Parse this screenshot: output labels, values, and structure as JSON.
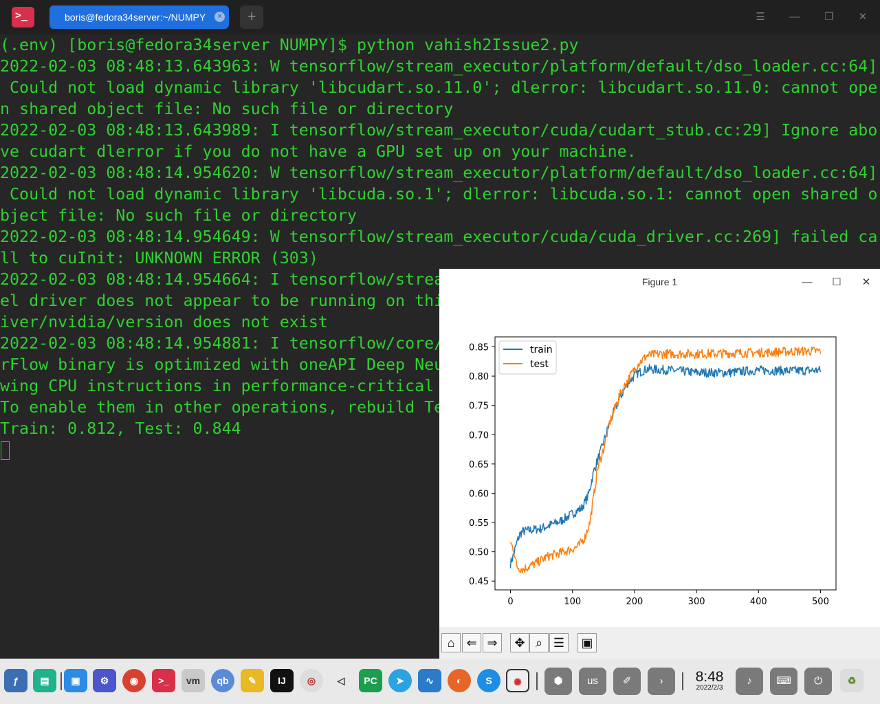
{
  "window": {
    "tab_title": "boris@fedora34server:~/NUMPY",
    "tab_close": "×",
    "new_tab": "+",
    "menu": "☰",
    "minimize": "—",
    "restore": "❐",
    "close": "✕"
  },
  "terminal": {
    "lines": [
      "(.env) [boris@fedora34server NUMPY]$ python vahish2Issue2.py",
      "2022-02-03 08:48:13.643963: W tensorflow/stream_executor/platform/default/dso_loader.cc:64]",
      " Could not load dynamic library 'libcudart.so.11.0'; dlerror: libcudart.so.11.0: cannot ope",
      "n shared object file: No such file or directory",
      "2022-02-03 08:48:13.643989: I tensorflow/stream_executor/cuda/cudart_stub.cc:29] Ignore abo",
      "ve cudart dlerror if you do not have a GPU set up on your machine.",
      "2022-02-03 08:48:14.954620: W tensorflow/stream_executor/platform/default/dso_loader.cc:64]",
      " Could not load dynamic library 'libcuda.so.1'; dlerror: libcuda.so.1: cannot open shared o",
      "bject file: No such file or directory",
      "2022-02-03 08:48:14.954649: W tensorflow/stream_executor/cuda/cuda_driver.cc:269] failed ca",
      "ll to cuInit: UNKNOWN ERROR (303)",
      "2022-02-03 08:48:14.954664: I tensorflow/strea",
      "el driver does not appear to be running on thi",
      "iver/nvidia/version does not exist",
      "2022-02-03 08:48:14.954881: I tensorflow/core/",
      "rFlow binary is optimized with oneAPI Deep Neu",
      "wing CPU instructions in performance-critical ",
      "To enable them in other operations, rebuild Te",
      "Train: 0.812, Test: 0.844"
    ]
  },
  "figure": {
    "title": "Figure 1",
    "minimize": "—",
    "maximize": "☐",
    "close": "✕",
    "toolbar": [
      "home-icon",
      "back-icon",
      "forward-icon",
      "pan-icon",
      "zoom-icon",
      "configure-icon",
      "save-icon"
    ]
  },
  "chart_data": {
    "type": "line",
    "title": "",
    "xlabel": "",
    "ylabel": "",
    "xlim": [
      -25,
      525
    ],
    "ylim": [
      0.435,
      0.867
    ],
    "xticks": [
      0,
      100,
      200,
      300,
      400,
      500
    ],
    "yticks": [
      0.45,
      0.5,
      0.55,
      0.6,
      0.65,
      0.7,
      0.75,
      0.8,
      0.85
    ],
    "legend": "top-left",
    "grid": false,
    "n_points": 500,
    "series": [
      {
        "name": "train",
        "color": "#1f77b4",
        "noise": 0.008,
        "keypoints": [
          [
            0,
            0.48
          ],
          [
            5,
            0.495
          ],
          [
            10,
            0.515
          ],
          [
            15,
            0.53
          ],
          [
            20,
            0.535
          ],
          [
            50,
            0.54
          ],
          [
            80,
            0.552
          ],
          [
            100,
            0.565
          ],
          [
            115,
            0.575
          ],
          [
            125,
            0.595
          ],
          [
            135,
            0.64
          ],
          [
            145,
            0.67
          ],
          [
            160,
            0.72
          ],
          [
            175,
            0.76
          ],
          [
            190,
            0.79
          ],
          [
            205,
            0.805
          ],
          [
            220,
            0.812
          ],
          [
            260,
            0.81
          ],
          [
            300,
            0.806
          ],
          [
            350,
            0.806
          ],
          [
            400,
            0.81
          ],
          [
            450,
            0.809
          ],
          [
            500,
            0.81
          ]
        ]
      },
      {
        "name": "test",
        "color": "#ff7f0e",
        "noise": 0.008,
        "keypoints": [
          [
            0,
            0.515
          ],
          [
            5,
            0.505
          ],
          [
            10,
            0.475
          ],
          [
            20,
            0.47
          ],
          [
            40,
            0.48
          ],
          [
            60,
            0.492
          ],
          [
            80,
            0.498
          ],
          [
            100,
            0.505
          ],
          [
            110,
            0.51
          ],
          [
            120,
            0.525
          ],
          [
            128,
            0.55
          ],
          [
            135,
            0.6
          ],
          [
            140,
            0.64
          ],
          [
            150,
            0.675
          ],
          [
            160,
            0.72
          ],
          [
            175,
            0.765
          ],
          [
            190,
            0.795
          ],
          [
            205,
            0.82
          ],
          [
            220,
            0.835
          ],
          [
            240,
            0.838
          ],
          [
            300,
            0.838
          ],
          [
            350,
            0.839
          ],
          [
            400,
            0.84
          ],
          [
            450,
            0.842
          ],
          [
            500,
            0.843
          ]
        ]
      }
    ]
  },
  "taskbar": {
    "clock_time": "8:48",
    "clock_date": "2022/2/3",
    "keyboard_layout": "us"
  }
}
